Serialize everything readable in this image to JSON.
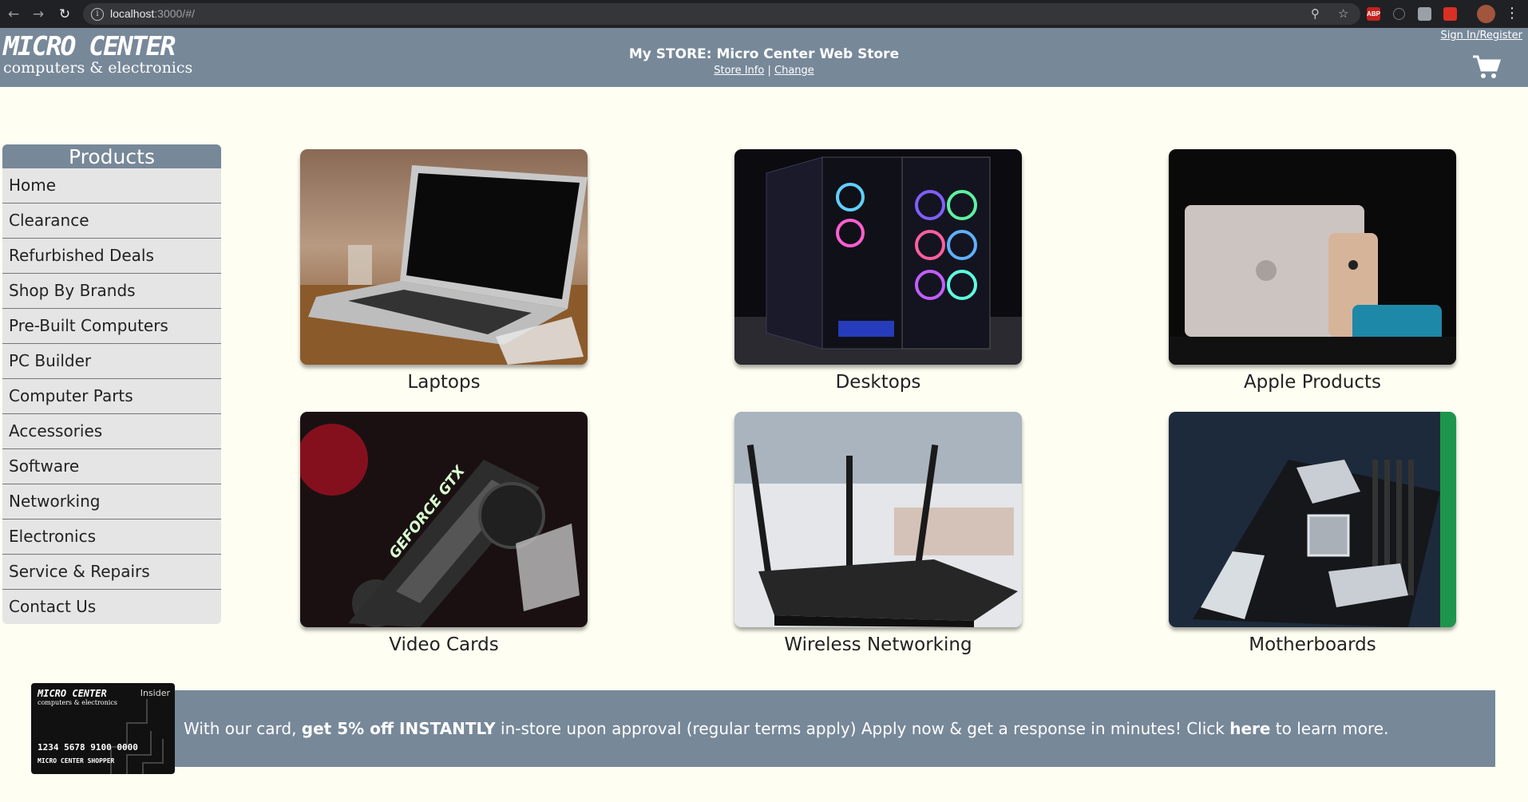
{
  "browser": {
    "url_host": "localhost",
    "url_rest": ":3000/#/",
    "ext_abp": "ABP"
  },
  "header": {
    "logo_line1": "MICRO CENTER",
    "logo_line2": "computers & electronics",
    "store_title": "My STORE: Micro Center Web Store",
    "store_info_link": "Store Info",
    "separator": "|",
    "change_link": "Change",
    "signin": "Sign In/Register"
  },
  "sidebar": {
    "heading": "Products",
    "items": [
      {
        "label": "Home"
      },
      {
        "label": "Clearance"
      },
      {
        "label": "Refurbished Deals"
      },
      {
        "label": "Shop By Brands"
      },
      {
        "label": "Pre-Built Computers"
      },
      {
        "label": "PC Builder"
      },
      {
        "label": "Computer Parts"
      },
      {
        "label": "Accessories"
      },
      {
        "label": "Software"
      },
      {
        "label": "Networking"
      },
      {
        "label": "Electronics"
      },
      {
        "label": "Service & Repairs"
      },
      {
        "label": "Contact Us"
      }
    ]
  },
  "categories": [
    {
      "label": "Laptops"
    },
    {
      "label": "Desktops"
    },
    {
      "label": "Apple Products"
    },
    {
      "label": "Video Cards",
      "image_text": "GEFORCE GTX"
    },
    {
      "label": "Wireless Networking"
    },
    {
      "label": "Motherboards"
    }
  ],
  "banner": {
    "text_1": "With our card, ",
    "text_bold_1": "get 5% off INSTANTLY",
    "text_2": " in-store upon approval (regular terms apply) Apply now & get a response in minutes! Click ",
    "link_here": "here",
    "text_3": " to learn more.",
    "card_brand": "MICRO CENTER",
    "card_sub": "computers & electronics",
    "card_tag": "Insider",
    "card_number": "1234 5678 9100 0000",
    "card_holder": "MICRO CENTER SHOPPER"
  },
  "colors": {
    "header_bg": "#778899",
    "page_bg": "#fefef2",
    "sidebar_item_bg": "#e5e5e5"
  }
}
